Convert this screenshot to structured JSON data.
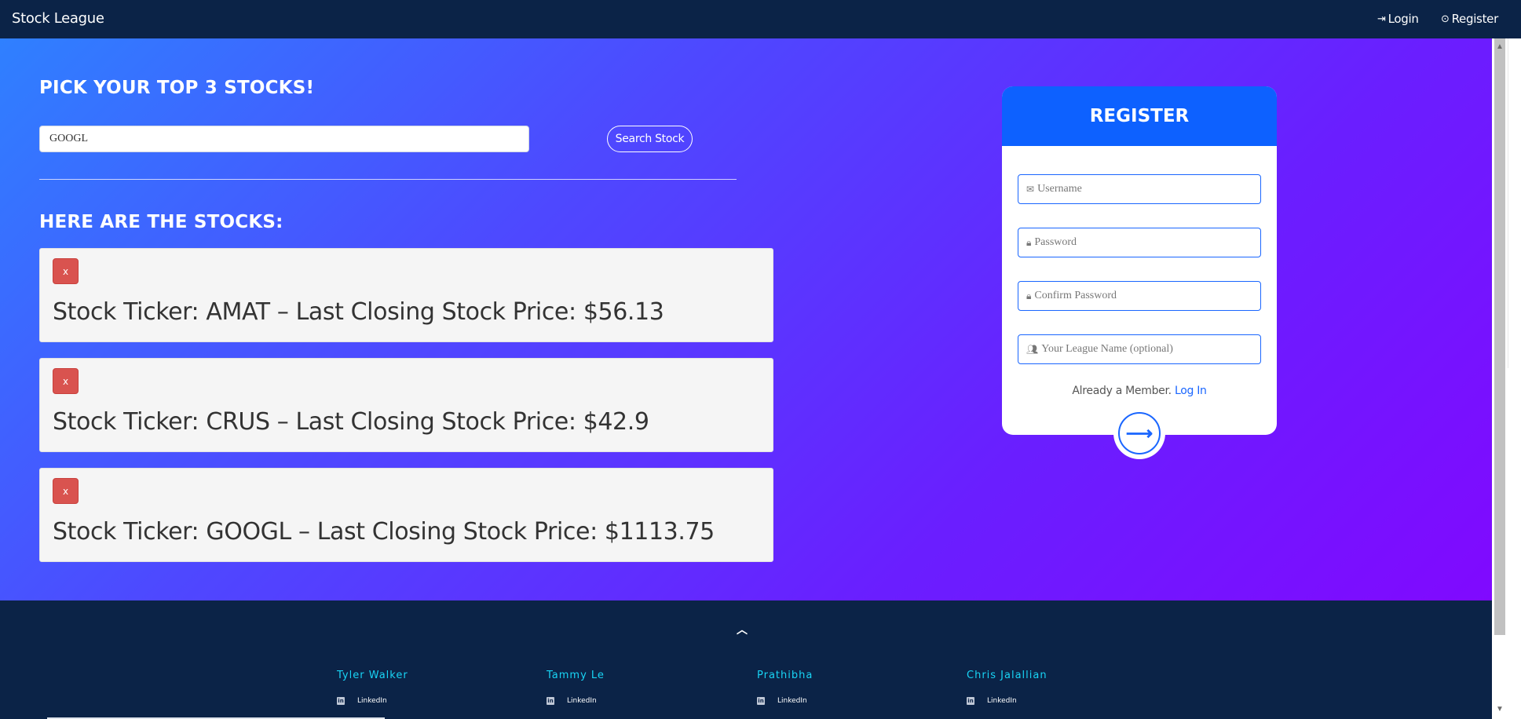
{
  "navbar": {
    "brand": "Stock League",
    "login_label": "Login",
    "register_label": "Register"
  },
  "stocks_section": {
    "pick_title": "PICK YOUR TOP 3 STOCKS!",
    "search_value": "GOOGL",
    "search_button_label": "Search Stock",
    "results_title": "HERE ARE THE STOCKS:",
    "remove_label": "x",
    "items": [
      {
        "text": "Stock Ticker: AMAT – Last Closing Stock Price: $56.13"
      },
      {
        "text": "Stock Ticker: CRUS – Last Closing Stock Price: $42.9"
      },
      {
        "text": "Stock Ticker: GOOGL – Last Closing Stock Price: $1113.75"
      }
    ]
  },
  "register_form": {
    "title": "REGISTER",
    "username_placeholder": "Username",
    "password_placeholder": "Password",
    "confirm_password_placeholder": "Confirm Password",
    "league_placeholder": "Your League Name (optional)",
    "member_text": "Already a Member.",
    "login_link": "Log In",
    "submit_icon": "arrow-right-icon"
  },
  "footer": {
    "members": [
      {
        "name": "Tyler Walker",
        "link_label": "LinkedIn"
      },
      {
        "name": "Tammy Le",
        "link_label": "LinkedIn"
      },
      {
        "name": "Prathibha",
        "link_label": "LinkedIn"
      },
      {
        "name": "Chris Jalallian",
        "link_label": "LinkedIn"
      }
    ]
  },
  "colors": {
    "navbar": "#0b2347",
    "accent": "#0d61ff",
    "remove_button": "#d9534f",
    "footer_name": "#18d4f5"
  }
}
